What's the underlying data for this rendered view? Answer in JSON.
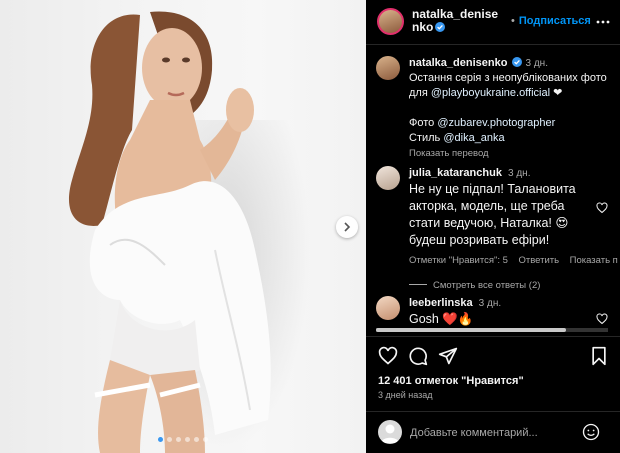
{
  "post": {
    "author": "natalka_denisenko",
    "follow_label": "Подписаться",
    "caption_time": "3 дн.",
    "caption_line1": "Остання серія з неопублікованих фото для ",
    "caption_mention": "@playboyukraine.official",
    "caption_emoji": " ❤",
    "credit_photo_prefix": "Фото ",
    "credit_photo": "@zubarev.photographer",
    "credit_style_prefix": "Стиль ",
    "credit_style": "@dika_anka",
    "translate_label": "Показать перевод",
    "likes": "12 401 отметок \"Нравится\"",
    "posted_ago": "3 дней назад"
  },
  "comments": [
    {
      "user": "julia_kataranchuk",
      "time": "3 дн.",
      "text": "Не ну це підпал! Талановита акторка, модель, ще треба стати ведучою, Наталка! 😍 будеш розривать ефіри!",
      "likes_label": "Отметки \"Нравится\": 5",
      "reply_label": "Ответить",
      "more_label": "Показать п",
      "view_replies": "Смотреть все ответы (2)"
    },
    {
      "user": "leeberlinska",
      "time": "3 дн.",
      "text": "Gosh ❤️🔥"
    }
  ],
  "composer": {
    "placeholder": "Добавьте комментарий..."
  },
  "carousel": {
    "slide_count": 6,
    "active_index": 0
  },
  "icons": {
    "like": "heart-icon",
    "comment": "comment-icon",
    "share": "paper-plane-icon",
    "save": "bookmark-icon",
    "more": "more-horizontal-icon",
    "verified": "verified-badge-icon",
    "next": "chevron-right-icon",
    "emoji": "smiley-icon"
  },
  "colors": {
    "accent": "#0095f6",
    "verified": "#3897f0",
    "like_red": "#ed4956"
  }
}
